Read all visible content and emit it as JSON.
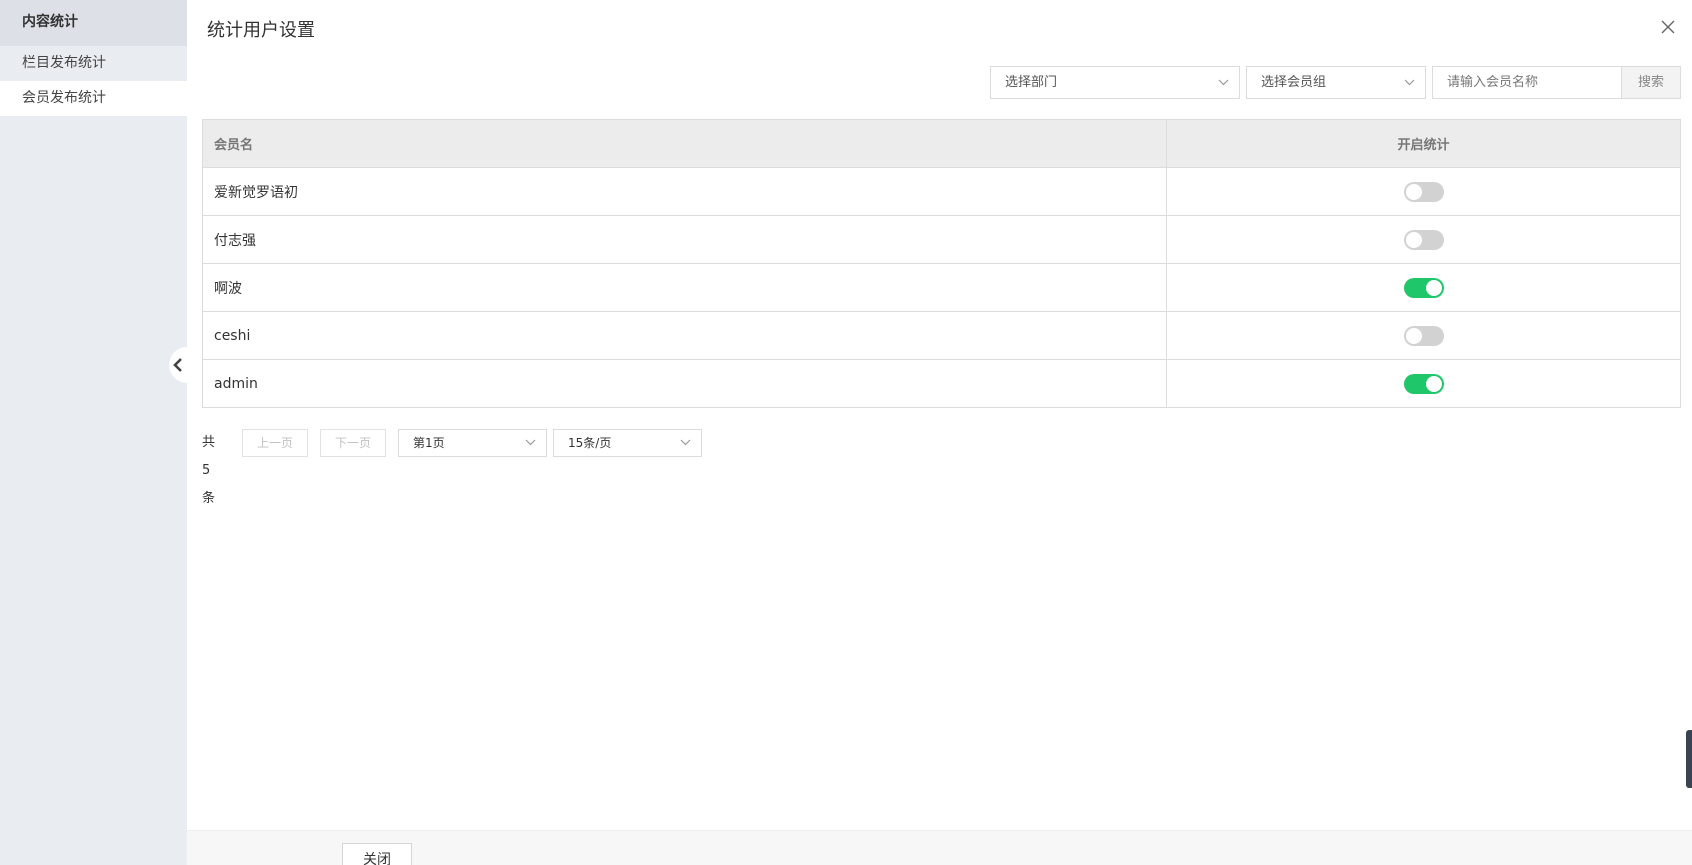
{
  "sidebar": {
    "header": "内容统计",
    "items": [
      {
        "label": "栏目发布统计"
      },
      {
        "label": "会员发布统计"
      }
    ]
  },
  "dialog": {
    "title": "统计用户设置"
  },
  "filters": {
    "department_select": "选择部门",
    "member_group_select": "选择会员组",
    "member_name_placeholder": "请输入会员名称",
    "search_label": "搜索"
  },
  "table": {
    "headers": [
      "会员名",
      "开启统计"
    ],
    "rows": [
      {
        "name": "爱新觉罗语初",
        "enabled": false
      },
      {
        "name": "付志强",
        "enabled": false
      },
      {
        "name": "啊波",
        "enabled": true
      },
      {
        "name": "ceshi",
        "enabled": false
      },
      {
        "name": "admin",
        "enabled": true
      }
    ]
  },
  "pagination": {
    "total": "共5条",
    "prev": "上一页",
    "next": "下一页",
    "page_select": "第1页",
    "page_size_select": "15条/页"
  },
  "footer": {
    "close_label": "关闭"
  },
  "colors": {
    "switch_on": "#1fc76a",
    "switch_off": "#d2d2d2"
  }
}
